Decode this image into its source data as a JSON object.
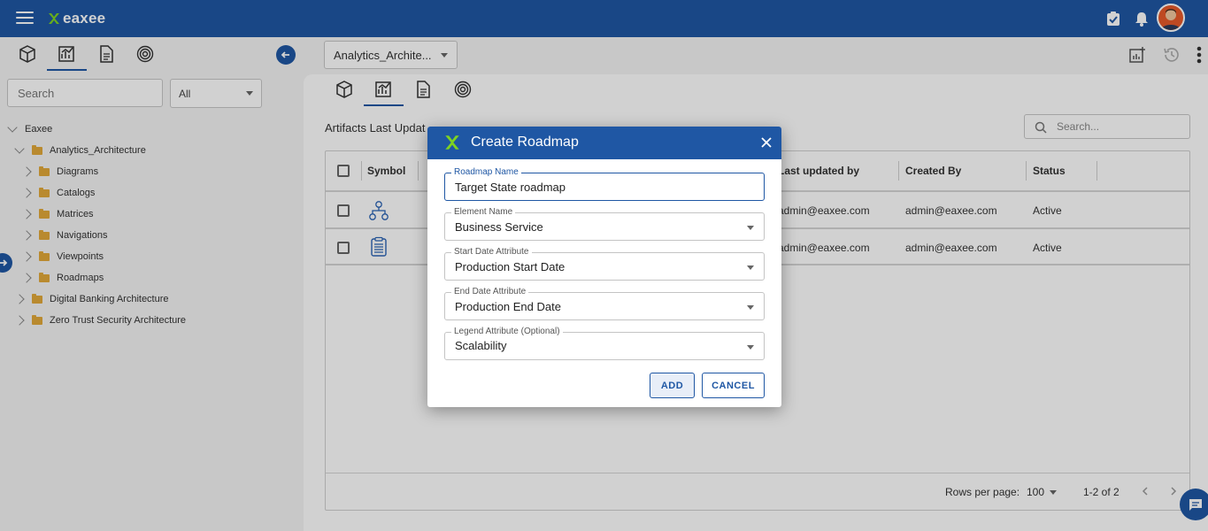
{
  "app": {
    "logo_text": "eaxee",
    "brand_color": "#1f57a4"
  },
  "topbar": {
    "icons": [
      "hamburger-icon",
      "tasks-icon",
      "bell-icon",
      "user-avatar"
    ]
  },
  "left_panel": {
    "tabs": [
      "cube-icon",
      "chart-icon",
      "document-icon",
      "target-icon"
    ],
    "search": {
      "placeholder": "Search"
    },
    "filter": {
      "value": "All"
    },
    "tree": [
      {
        "label": "Eaxee",
        "level": 0,
        "expanded": true,
        "folder": false
      },
      {
        "label": "Analytics_Architecture",
        "level": 1,
        "expanded": true,
        "folder": true
      },
      {
        "label": "Diagrams",
        "level": 2,
        "expanded": false,
        "folder": true
      },
      {
        "label": "Catalogs",
        "level": 2,
        "expanded": false,
        "folder": true
      },
      {
        "label": "Matrices",
        "level": 2,
        "expanded": false,
        "folder": true
      },
      {
        "label": "Navigations",
        "level": 2,
        "expanded": false,
        "folder": true
      },
      {
        "label": "Viewpoints",
        "level": 2,
        "expanded": false,
        "folder": true
      },
      {
        "label": "Roadmaps",
        "level": 2,
        "expanded": false,
        "folder": true
      },
      {
        "label": "Digital Banking Architecture",
        "level": 1,
        "expanded": false,
        "folder": true
      },
      {
        "label": "Zero Trust Security Architecture",
        "level": 1,
        "expanded": false,
        "folder": true
      }
    ]
  },
  "main": {
    "project_select": "Analytics_Archite...",
    "section_title": "Artifacts Last Updat",
    "search_placeholder": "Search...",
    "columns": {
      "symbol": "Symbol",
      "last_updated_by": "Last updated by",
      "created_by": "Created By",
      "status": "Status"
    },
    "rows": [
      {
        "last_updated_by": "admin@eaxee.com",
        "created_by": "admin@eaxee.com",
        "status": "Active"
      },
      {
        "last_updated_by": "admin@eaxee.com",
        "created_by": "admin@eaxee.com",
        "status": "Active"
      }
    ],
    "footer": {
      "rows_per_page_label": "Rows per page:",
      "rows_per_page_value": "100",
      "range": "1-2 of 2"
    }
  },
  "dialog": {
    "title": "Create Roadmap",
    "fields": {
      "roadmap_name": {
        "label": "Roadmap Name",
        "value": "Target State roadmap"
      },
      "element_name": {
        "label": "Element Name",
        "value": "Business Service"
      },
      "start_date": {
        "label": "Start Date Attribute",
        "value": "Production Start Date"
      },
      "end_date": {
        "label": "End Date Attribute",
        "value": "Production End Date"
      },
      "legend": {
        "label": "Legend Attribute (Optional)",
        "value": "Scalability"
      }
    },
    "buttons": {
      "add": "ADD",
      "cancel": "CANCEL"
    }
  }
}
